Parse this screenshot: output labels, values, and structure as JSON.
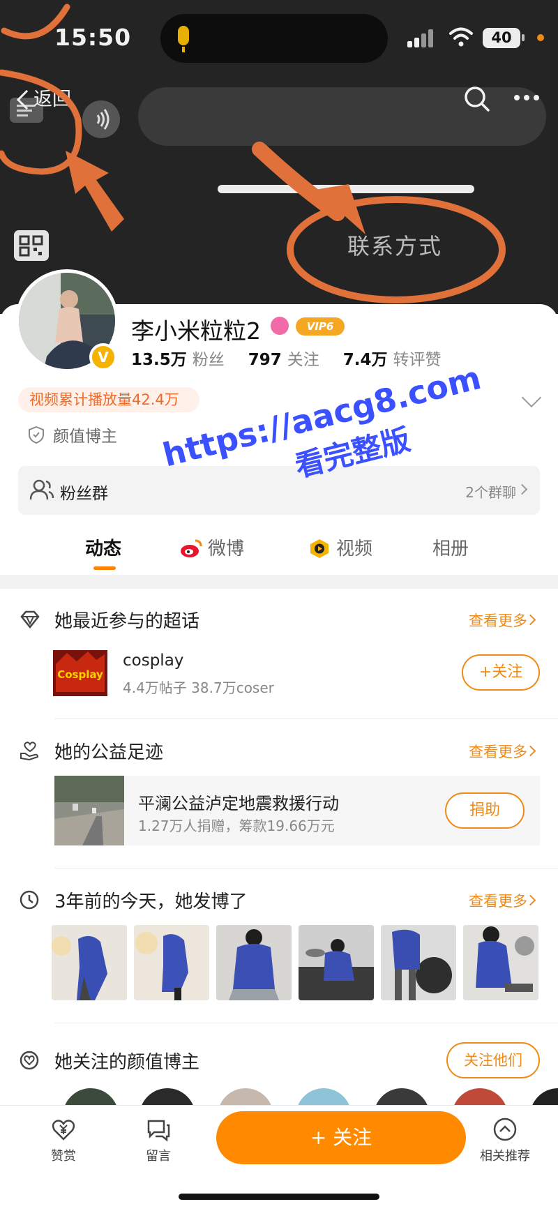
{
  "status_bar": {
    "time": "15:50",
    "battery": "40"
  },
  "nav": {
    "back_label": "返回",
    "contact_label": "联系方式"
  },
  "profile": {
    "name": "李小米粒粒2",
    "vip_label": "VIP6",
    "stats": [
      {
        "value": "13.5万",
        "label": "粉丝"
      },
      {
        "value": "797",
        "label": "关注"
      },
      {
        "value": "7.4万",
        "label": "转评赞"
      }
    ],
    "play_count": "视频累计播放量42.4万",
    "tag": "颜值博主",
    "fan_group": {
      "label": "粉丝群",
      "count": "2个群聊"
    }
  },
  "watermark": {
    "line1": "https://aacg8.com",
    "line2": "看完整版"
  },
  "tabs": [
    {
      "label": "动态",
      "icon": "none",
      "active": true
    },
    {
      "label": "微博",
      "icon": "weibo-icon",
      "active": false
    },
    {
      "label": "视频",
      "icon": "video-icon",
      "active": false
    },
    {
      "label": "相册",
      "icon": "none",
      "active": false
    }
  ],
  "super_topics": {
    "title": "她最近参与的超话",
    "more": "查看更多",
    "item": {
      "image_text": "Cosplay",
      "name": "cosplay",
      "meta": "4.4万帖子 38.7万coser",
      "button": "+关注"
    }
  },
  "charity": {
    "title": "她的公益足迹",
    "more": "查看更多",
    "item": {
      "name": "平澜公益泸定地震救援行动",
      "meta": "1.27万人捐赠，筹款19.66万元",
      "button": "捐助"
    }
  },
  "memories": {
    "title": "3年前的今天，她发博了",
    "more": "查看更多",
    "photo_count": 6
  },
  "followed_bloggers": {
    "title": "她关注的颜值博主",
    "button": "关注他们"
  },
  "bottom_bar": {
    "reward": "赞赏",
    "message": "留言",
    "follow": "+ 关注",
    "recommend": "相关推荐"
  },
  "colors": {
    "accent": "#f08a16",
    "follow_button": "#ff8a00",
    "banner": "#242424",
    "watermark": "#3b50ff"
  }
}
